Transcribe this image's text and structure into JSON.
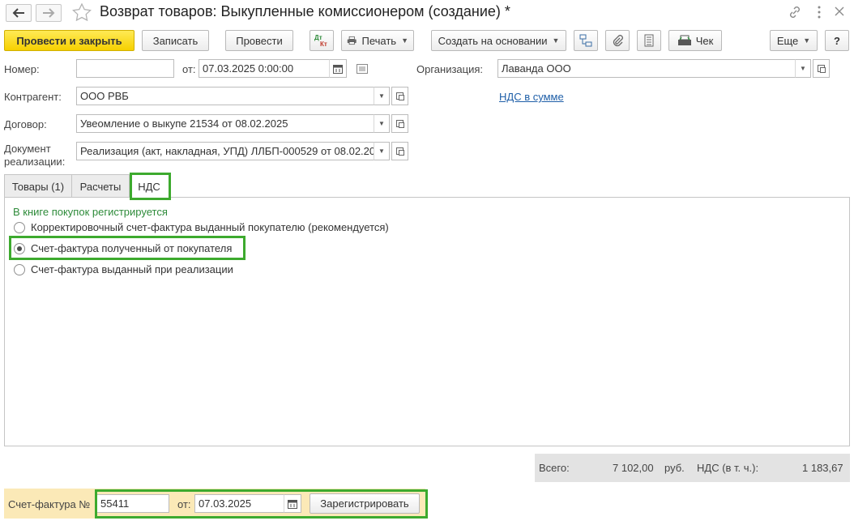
{
  "window": {
    "title": "Возврат товаров: Выкупленные комиссионером (создание) *"
  },
  "toolbar": {
    "post_close": "Провести и закрыть",
    "save": "Записать",
    "post": "Провести",
    "dt_kt": "Дт/Кт",
    "print": "Печать",
    "create_based": "Создать на основании",
    "check": "Чек",
    "more": "Еще",
    "help": "?"
  },
  "form": {
    "number_label": "Номер:",
    "number_value": "",
    "from_label": "от:",
    "date_value": "07.03.2025  0:00:00",
    "org_label": "Организация:",
    "org_value": "Лаванда ООО",
    "contractor_label": "Контрагент:",
    "contractor_value": "ООО РВБ",
    "vat_link": "НДС в сумме",
    "contract_label": "Договор:",
    "contract_value": "Увеомление о выкупе 21534 от 08.02.2025",
    "realization_label_1": "Документ",
    "realization_label_2": "реализации:",
    "realization_value": "Реализация (акт, накладная, УПД) ЛЛБП-000529 от 08.02.20"
  },
  "tabs": [
    {
      "label": "Товары (1)"
    },
    {
      "label": "Расчеты"
    },
    {
      "label": "НДС"
    }
  ],
  "vat_tab": {
    "heading": "В книге покупок регистрируется",
    "options": [
      {
        "label": "Корректировочный счет-фактура выданный покупателю (рекомендуется)",
        "selected": false
      },
      {
        "label": "Счет-фактура полученный от покупателя",
        "selected": true
      },
      {
        "label": "Счет-фактура выданный при реализации",
        "selected": false
      }
    ]
  },
  "totals": {
    "total_label": "Всего:",
    "total_value": "7 102,00",
    "currency": "руб.",
    "vat_label": "НДС (в т. ч.):",
    "vat_value": "1 183,67"
  },
  "invoice": {
    "label": "Счет-фактура №",
    "number": "55411",
    "from_label": "от:",
    "date": "07.03.2025",
    "register_button": "Зарегистрировать"
  },
  "colors": {
    "primary_button": "#f6d000",
    "highlight": "#3daa2e",
    "link": "#1f5fa8",
    "heading_green": "#2e8b3a",
    "invoice_bar": "#fbe9b7"
  }
}
